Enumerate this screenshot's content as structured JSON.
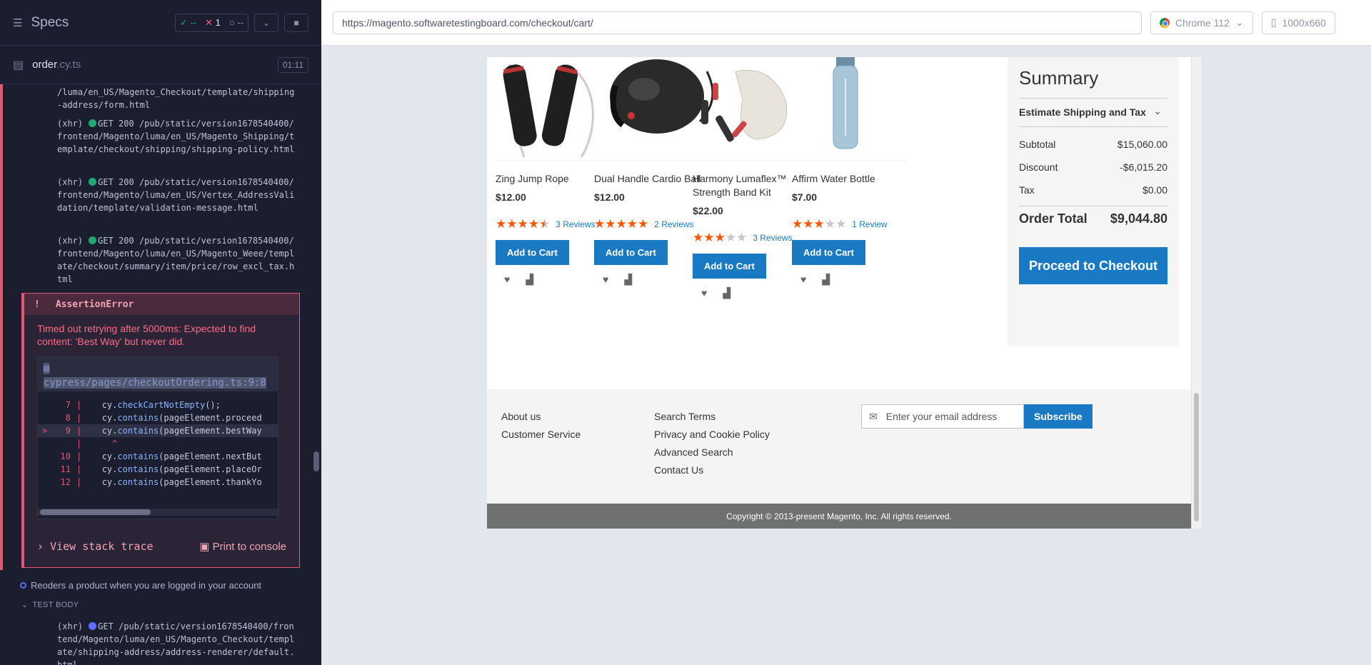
{
  "reporter": {
    "title": "Specs",
    "stats": {
      "passed": "--",
      "failed": "1",
      "pending": "--"
    },
    "spec": {
      "name": "order",
      "ext": ".cy.ts",
      "duration": "01:11"
    },
    "commands": [
      {
        "prefix": "",
        "status": "",
        "text": "/luma/en_US/Magento_Checkout/template/shipping-address/form.html"
      },
      {
        "prefix": "(xhr)",
        "status": "GET 200",
        "text": "/pub/static/version1678540400/frontend/Magento/luma/en_US/Magento_Shipping/template/checkout/shipping/shipping-policy.html"
      },
      {
        "prefix": "(xhr)",
        "status": "GET 200",
        "text": "/pub/static/version1678540400/frontend/Magento/luma/en_US/Vertex_AddressValidation/template/validation-message.html"
      },
      {
        "prefix": "(xhr)",
        "status": "GET 200",
        "text": "/pub/static/version1678540400/frontend/Magento/luma/en_US/Magento_Weee/template/checkout/summary/item/price/row_excl_tax.html"
      }
    ],
    "error": {
      "type": "AssertionError",
      "message": "Timed out retrying after 5000ms: Expected to find content: 'Best Way' but never did.",
      "file": "cypress/pages/checkoutOrdering.ts:9:8",
      "code_lines": [
        {
          "n": "7",
          "pre": "cy.",
          "method": "checkCartNotEmpty",
          "post": "();"
        },
        {
          "n": "8",
          "pre": "cy.",
          "method": "contains",
          "post": "(pageElement.proceed"
        },
        {
          "n": "9",
          "pre": "cy.",
          "method": "contains",
          "post": "(pageElement.bestWay"
        },
        {
          "n": "",
          "pre": "  ^",
          "method": "",
          "post": ""
        },
        {
          "n": "10",
          "pre": "cy.",
          "method": "contains",
          "post": "(pageElement.nextBut"
        },
        {
          "n": "11",
          "pre": "cy.",
          "method": "contains",
          "post": "(pageElement.placeOr"
        },
        {
          "n": "12",
          "pre": "cy.",
          "method": "contains",
          "post": "(pageElement.thankYo"
        }
      ],
      "stack_label": "View stack trace",
      "print_label": "Print to console"
    },
    "next_test": "Reoders a product when you are logged in your account",
    "test_body": "TEST BODY",
    "last_cmd": {
      "prefix": "(xhr)",
      "status": "GET",
      "text": "/pub/static/version1678540400/frontend/Magento/luma/en_US/Magento_Checkout/template/shipping-address/address-renderer/default.html"
    }
  },
  "browser": {
    "url": "https://magento.softwaretestingboard.com/checkout/cart/",
    "browser_name": "Chrome 112",
    "viewport": "1000x660"
  },
  "products": [
    {
      "name": "Zing Jump Rope",
      "price": "$12.00",
      "rating": 4.5,
      "reviews": "3 Reviews",
      "add_label": "Add to Cart"
    },
    {
      "name": "Dual Handle Cardio Ball",
      "price": "$12.00",
      "rating": 5,
      "reviews": "2 Reviews",
      "add_label": "Add to Cart"
    },
    {
      "name": "Harmony Lumaflex™ Strength Band Kit",
      "price": "$22.00",
      "rating": 3,
      "reviews": "3 Reviews",
      "add_label": "Add to Cart"
    },
    {
      "name": "Affirm Water Bottle",
      "price": "$7.00",
      "rating": 3,
      "reviews": "1 Review",
      "add_label": "Add to Cart"
    }
  ],
  "summary": {
    "title": "Summary",
    "estimate": "Estimate Shipping and Tax",
    "rows": [
      {
        "label": "Subtotal",
        "value": "$15,060.00"
      },
      {
        "label": "Discount",
        "value": "-$6,015.20"
      },
      {
        "label": "Tax",
        "value": "$0.00"
      }
    ],
    "total_label": "Order Total",
    "total_value": "$9,044.80",
    "checkout_label": "Proceed to Checkout"
  },
  "footer": {
    "col1": [
      "About us",
      "Customer Service"
    ],
    "col2": [
      "Search Terms",
      "Privacy and Cookie Policy",
      "Advanced Search",
      "Contact Us"
    ],
    "email_placeholder": "Enter your email address",
    "subscribe_label": "Subscribe",
    "copyright": "Copyright © 2013-present Magento, Inc. All rights reserved."
  },
  "colors": {
    "accent": "#1979c3",
    "star": "#ff5501",
    "error": "#e45770",
    "pass": "#1fa971"
  }
}
